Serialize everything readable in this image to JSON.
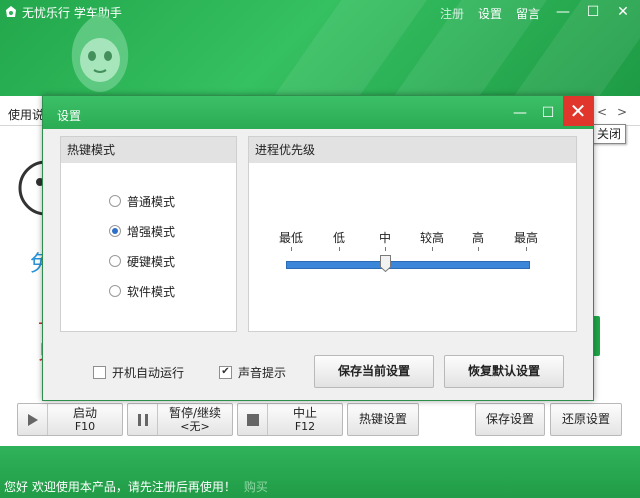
{
  "app": {
    "title": "无忧乐行 学车助手",
    "links": {
      "register": "注册",
      "settings": "设置",
      "message": "留言"
    },
    "usage_tab": "使用说",
    "faded": {
      "blue": "免",
      "red1": "上",
      "red2": "贝"
    }
  },
  "tooltip": {
    "close": "关闭"
  },
  "dialog": {
    "title": "设置",
    "hotkey_group": {
      "title": "热键模式",
      "options": [
        {
          "label": "普通模式",
          "selected": false
        },
        {
          "label": "增强模式",
          "selected": true
        },
        {
          "label": "硬键模式",
          "selected": false
        },
        {
          "label": "软件模式",
          "selected": false
        }
      ]
    },
    "priority_group": {
      "title": "进程优先级",
      "levels": [
        "最低",
        "低",
        "中",
        "较高",
        "高",
        "最高"
      ],
      "selected_index": 2
    },
    "autostart": {
      "label": "开机自动运行",
      "checked": false
    },
    "sound": {
      "label": "声音提示",
      "checked": true
    },
    "save_button": "保存当前设置",
    "restore_button": "恢复默认设置"
  },
  "controls": {
    "start": {
      "label": "启动",
      "key": "F10"
    },
    "pause": {
      "label": "暂停/继续",
      "key": "<无>"
    },
    "stop": {
      "label": "中止",
      "key": "F12"
    },
    "hotkey_settings": "热键设置",
    "save_settings": "保存设置",
    "restore_settings": "还原设置"
  },
  "status": {
    "message": "您好 欢迎使用本产品，请先注册后再使用！",
    "buy": "购买"
  },
  "colors": {
    "brand_green": "#2fb35a",
    "close_red": "#e0362c",
    "slider_blue": "#3b86d8"
  }
}
